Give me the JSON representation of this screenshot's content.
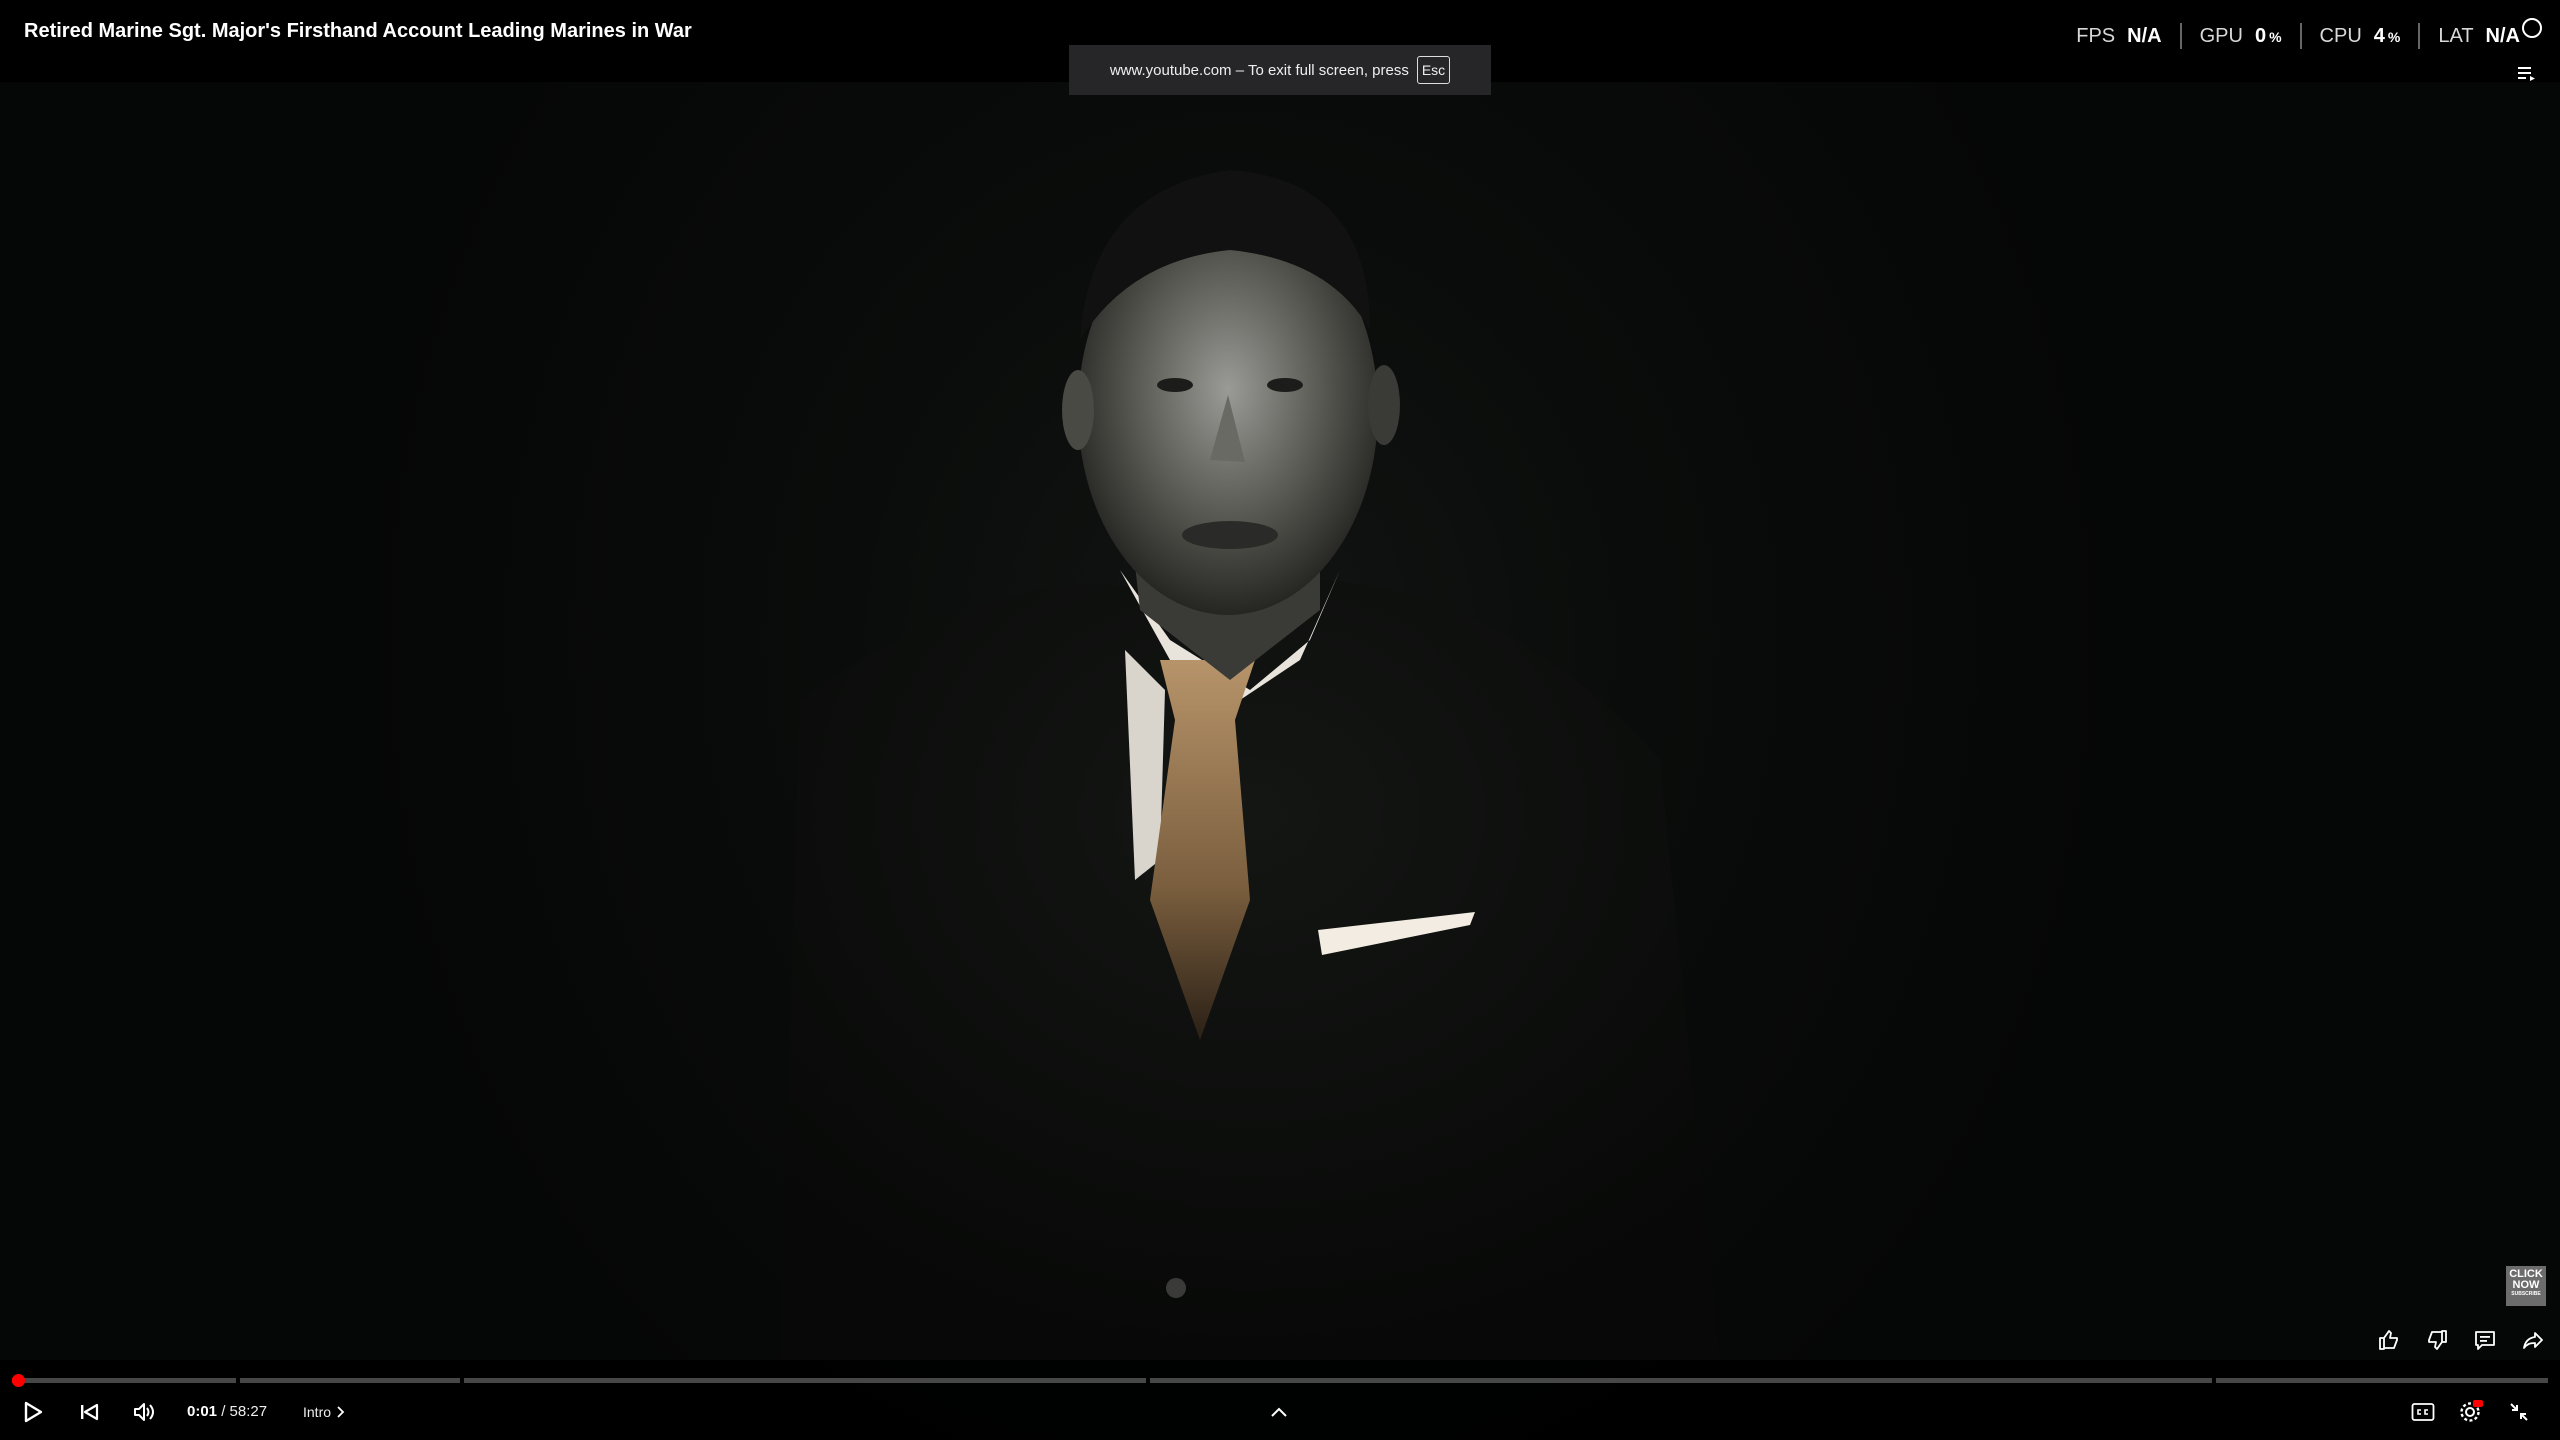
{
  "video": {
    "title": "Retired Marine Sgt. Major's Firsthand Account Leading Marines in War"
  },
  "perf_overlay": {
    "fps": {
      "label": "FPS",
      "value": "N/A",
      "unit": ""
    },
    "gpu": {
      "label": "GPU",
      "value": "0",
      "unit": "%"
    },
    "cpu": {
      "label": "CPU",
      "value": "4",
      "unit": "%"
    },
    "lat": {
      "label": "LAT",
      "value": "N/A",
      "unit": ""
    }
  },
  "fullscreen_toast": {
    "message": "www.youtube.com – To exit full screen, press",
    "key": "Esc"
  },
  "watermark": {
    "line1": "CLICK",
    "line2": "NOW",
    "line3": "SUBSCRIBE"
  },
  "playback": {
    "current_time": "0:01",
    "separator": " / ",
    "duration": "58:27",
    "progress_fraction": 0.0003,
    "chapter": "Intro"
  },
  "colors": {
    "progress_played": "#ff0000",
    "background": "#000000"
  },
  "icons": {
    "play": "play-icon",
    "previous": "previous-icon",
    "volume": "volume-icon",
    "chapters": "chevron-up-icon",
    "captions": "captions-icon",
    "settings": "settings-icon",
    "exit_fullscreen": "exit-fullscreen-icon",
    "like": "thumbs-up-icon",
    "dislike": "thumbs-down-icon",
    "comments": "comment-icon",
    "share": "share-icon",
    "playlist": "playlist-icon",
    "info": "info-icon"
  }
}
